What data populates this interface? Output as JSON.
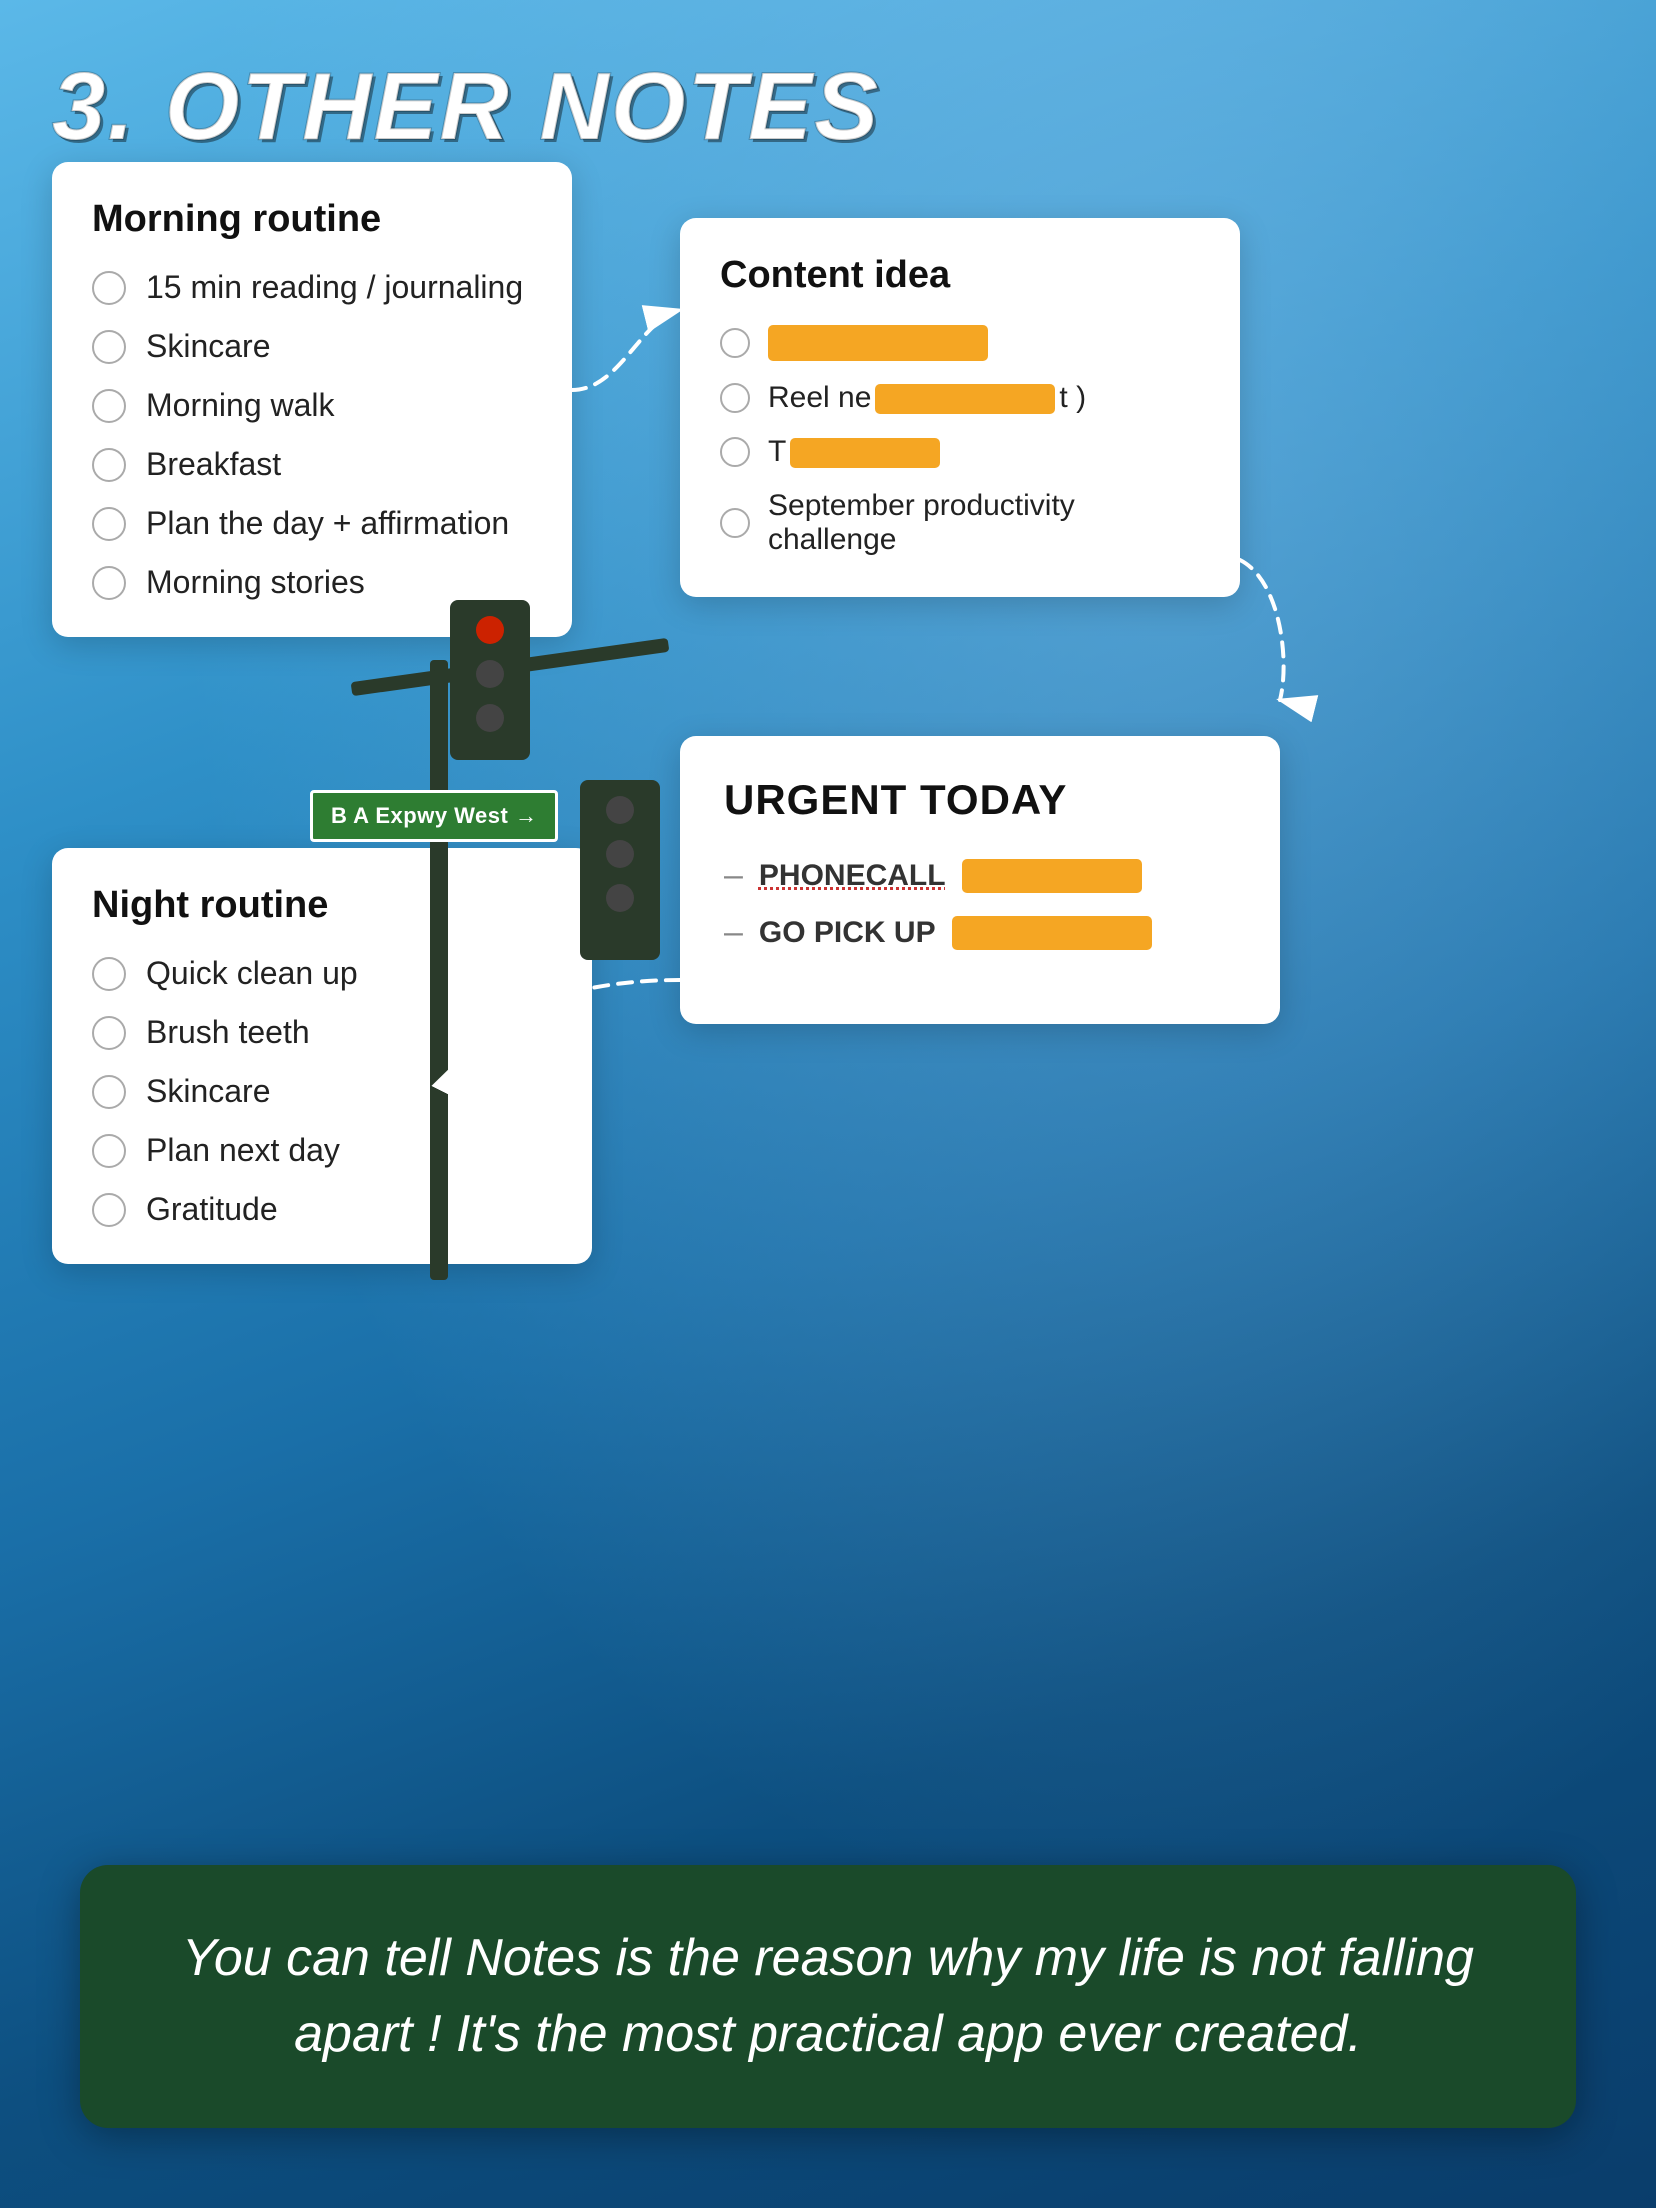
{
  "title": "3. OTHER NOTES",
  "morning_card": {
    "title": "Morning routine",
    "items": [
      "15 min reading / journaling",
      "Skincare",
      "Morning walk",
      "Breakfast",
      "Plan the day + affirmation",
      "Morning stories"
    ]
  },
  "content_card": {
    "title": "Content idea",
    "items": [
      {
        "type": "redact",
        "text": "",
        "redact_width": 220,
        "suffix": ""
      },
      {
        "type": "mixed",
        "prefix": "Reel ne",
        "redact_width": 180,
        "suffix": "t )"
      },
      {
        "type": "redact",
        "text": "",
        "redact_width": 150,
        "suffix": ""
      },
      {
        "type": "text",
        "text": "September productivity challenge"
      }
    ]
  },
  "urgent_card": {
    "title": "URGENT TODAY",
    "items": [
      {
        "label": "PHONECALL",
        "has_redact": true,
        "redact_width": 180
      },
      {
        "label": "GO PICK UP",
        "has_redact": true,
        "redact_width": 200
      }
    ]
  },
  "night_card": {
    "title": "Night routine",
    "items": [
      "Quick clean up",
      "Brush teeth",
      "Skincare",
      "Plan next day",
      "Gratitude"
    ]
  },
  "road_sign": "B A Expwy West →",
  "quote": "You can tell Notes is the reason why my life is not falling apart ! It's the most practical app ever created."
}
